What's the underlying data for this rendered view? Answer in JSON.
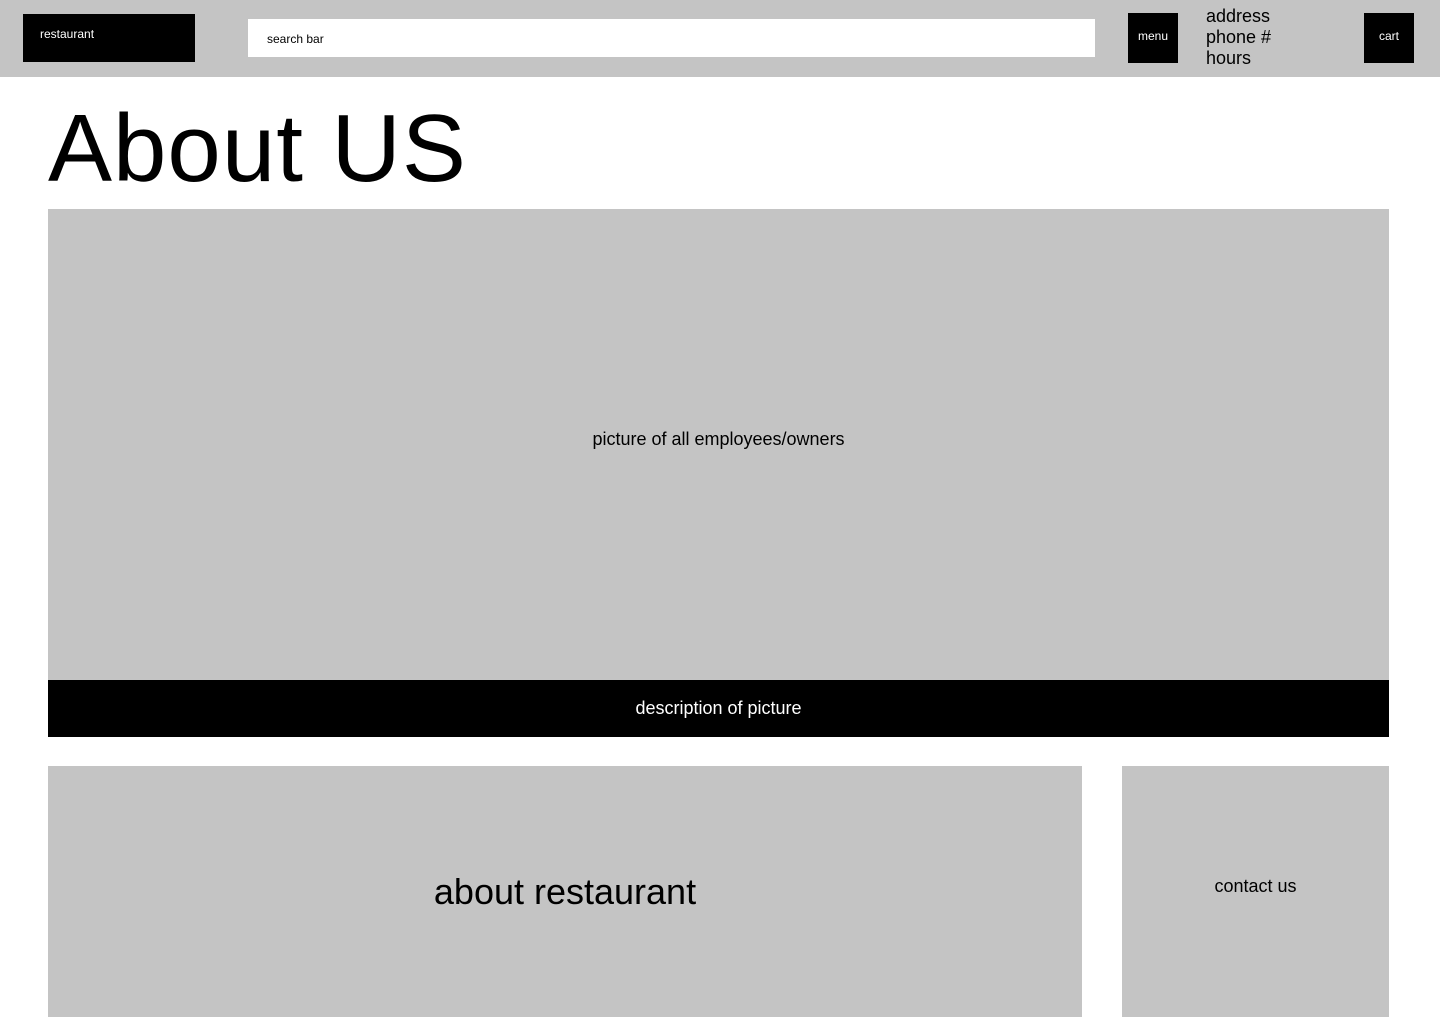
{
  "header": {
    "logo_label": "restaurant",
    "search_placeholder": "search bar",
    "menu_label": "menu",
    "info": {
      "address": "address",
      "phone": "phone #",
      "hours": "hours"
    },
    "cart_label": "cart"
  },
  "main": {
    "title": "About US",
    "photo_placeholder": "picture of all employees/owners",
    "photo_caption": "description of picture",
    "about_label": "about restaurant",
    "contact_label": "contact us"
  },
  "colors": {
    "placeholder_gray": "#c4c4c4",
    "block_black": "#000000",
    "background": "#ffffff"
  }
}
